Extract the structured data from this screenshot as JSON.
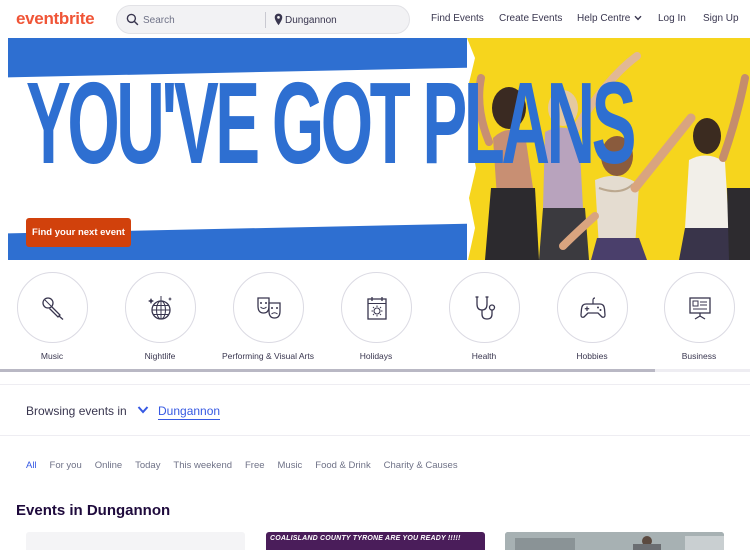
{
  "header": {
    "logo": "eventbrite",
    "search_placeholder": "Search",
    "location_value": "Dungannon",
    "nav": {
      "find_events": "Find Events",
      "create_events": "Create Events",
      "help_centre": "Help Centre",
      "log_in": "Log In",
      "sign_up": "Sign Up"
    }
  },
  "hero": {
    "headline": "YOU'VE GOT PLANS",
    "cta_label": "Find your next event",
    "colors": {
      "blue": "#2e6fd1",
      "yellow": "#f6d51d",
      "cta": "#d1410c"
    }
  },
  "categories": [
    {
      "label": "Music",
      "icon": "microphone-icon"
    },
    {
      "label": "Nightlife",
      "icon": "disco-ball-icon"
    },
    {
      "label": "Performing & Visual Arts",
      "icon": "theater-masks-icon"
    },
    {
      "label": "Holidays",
      "icon": "calendar-sun-icon"
    },
    {
      "label": "Health",
      "icon": "stethoscope-icon"
    },
    {
      "label": "Hobbies",
      "icon": "gamepad-icon"
    },
    {
      "label": "Business",
      "icon": "presentation-board-icon"
    }
  ],
  "browse": {
    "label": "Browsing events in",
    "location": "Dungannon"
  },
  "tabs": [
    {
      "label": "All",
      "active": true
    },
    {
      "label": "For you",
      "active": false
    },
    {
      "label": "Online",
      "active": false
    },
    {
      "label": "Today",
      "active": false
    },
    {
      "label": "This weekend",
      "active": false
    },
    {
      "label": "Free",
      "active": false
    },
    {
      "label": "Music",
      "active": false
    },
    {
      "label": "Food & Drink",
      "active": false
    },
    {
      "label": "Charity & Causes",
      "active": false
    }
  ],
  "events": {
    "title": "Events in Dungannon",
    "cards": [
      {
        "banner_text": ""
      },
      {
        "banner_text": "COALISLAND COUNTY TYRONE ARE YOU READY !!!!!"
      },
      {
        "banner_text": ""
      }
    ]
  }
}
